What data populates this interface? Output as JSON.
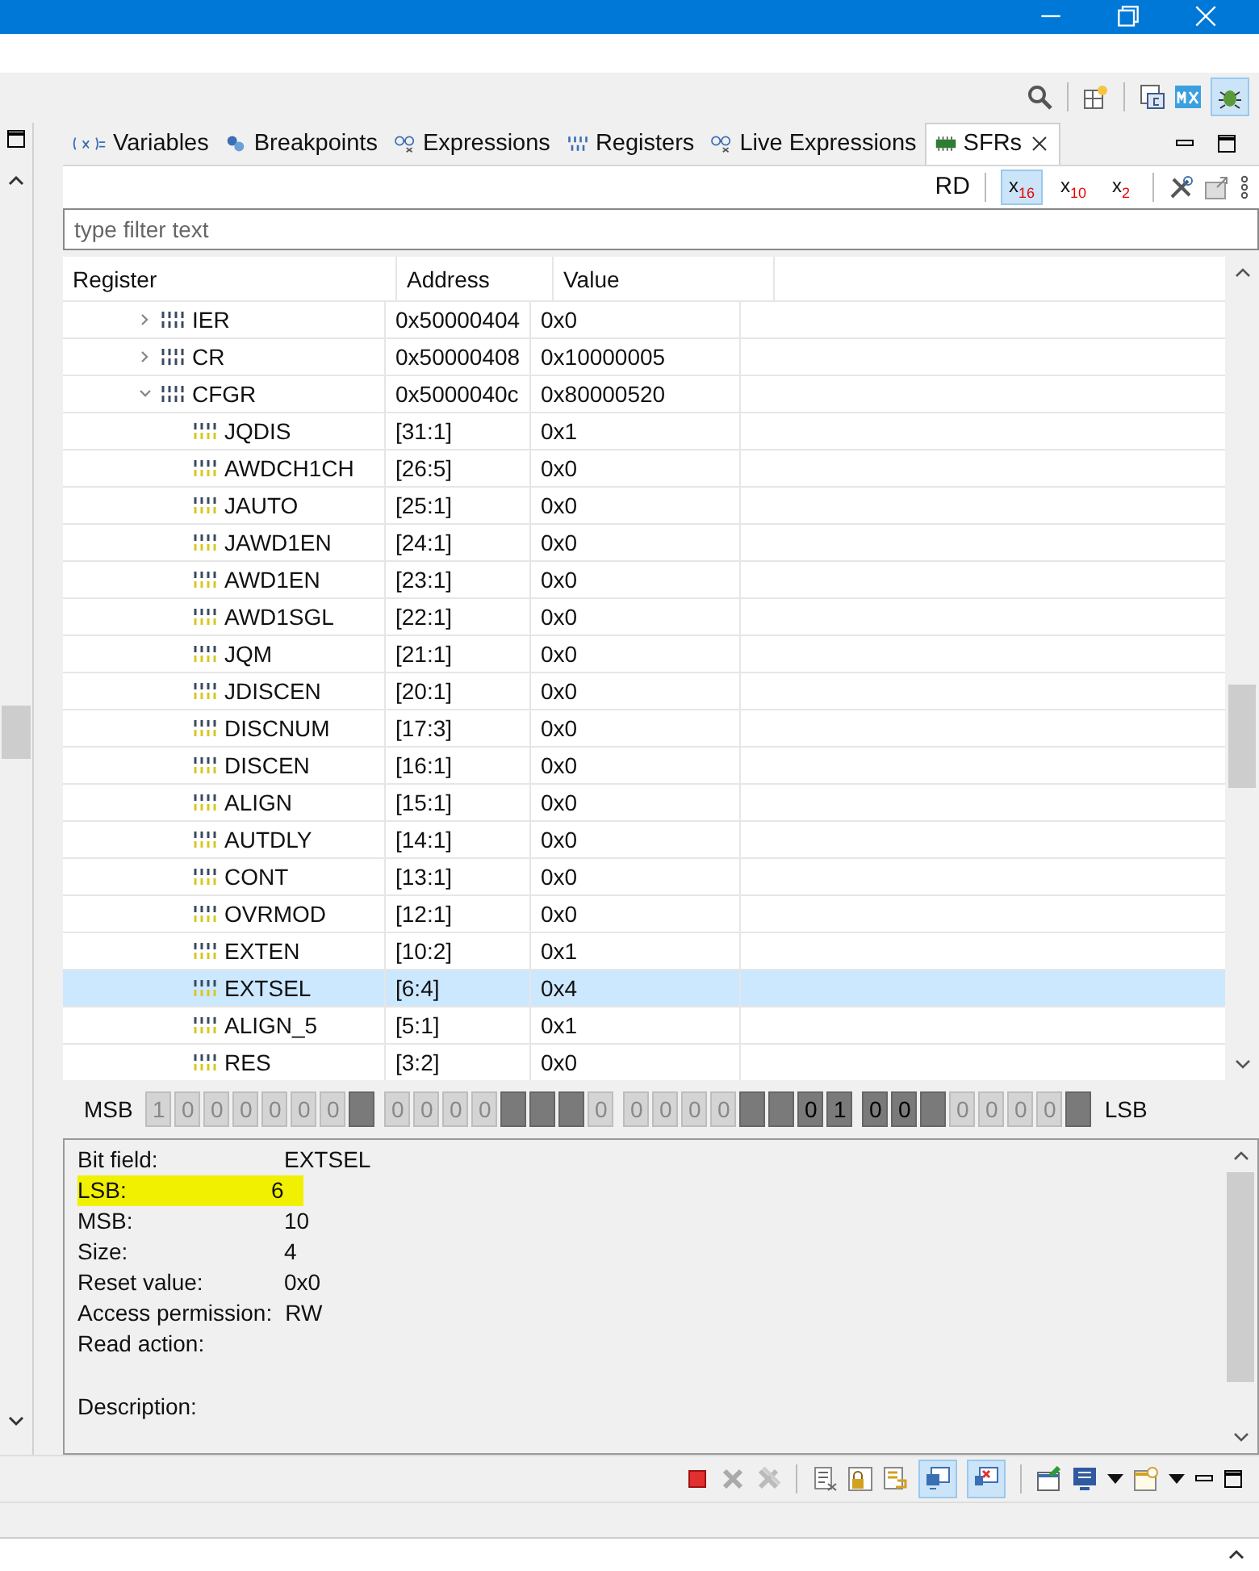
{
  "top_toolbar": {
    "debug_perspective_on": true
  },
  "tabs": [
    {
      "label": "Variables",
      "selected": false
    },
    {
      "label": "Breakpoints",
      "selected": false
    },
    {
      "label": "Expressions",
      "selected": false
    },
    {
      "label": "Registers",
      "selected": false
    },
    {
      "label": "Live Expressions",
      "selected": false
    },
    {
      "label": "SFRs",
      "selected": true
    }
  ],
  "view_toolbar": {
    "rd_label": "RD",
    "formats": [
      {
        "label": "x$_{16}$",
        "selected": true
      },
      {
        "label": "x$_{10}$",
        "selected": false
      },
      {
        "label": "x$_{2}$",
        "selected": false
      }
    ]
  },
  "filter": {
    "placeholder": "type filter text"
  },
  "table": {
    "columns": [
      "Register",
      "Address",
      "Value"
    ],
    "rows": [
      {
        "name": "IER",
        "address": "0x50000404",
        "value": "0x0",
        "expanded": false,
        "selected": false
      },
      {
        "name": "CR",
        "address": "0x50000408",
        "value": "0x10000005",
        "expanded": false,
        "selected": false
      },
      {
        "name": "CFGR",
        "address": "0x5000040c",
        "value": "0x80000520",
        "expanded": true,
        "selected": false,
        "children": [
          {
            "name": "JQDIS",
            "address": "[31:1]",
            "value": "0x1",
            "selected": false
          },
          {
            "name": "AWDCH1CH",
            "address": "[26:5]",
            "value": "0x0",
            "selected": false
          },
          {
            "name": "JAUTO",
            "address": "[25:1]",
            "value": "0x0",
            "selected": false
          },
          {
            "name": "JAWD1EN",
            "address": "[24:1]",
            "value": "0x0",
            "selected": false
          },
          {
            "name": "AWD1EN",
            "address": "[23:1]",
            "value": "0x0",
            "selected": false
          },
          {
            "name": "AWD1SGL",
            "address": "[22:1]",
            "value": "0x0",
            "selected": false
          },
          {
            "name": "JQM",
            "address": "[21:1]",
            "value": "0x0",
            "selected": false
          },
          {
            "name": "JDISCEN",
            "address": "[20:1]",
            "value": "0x0",
            "selected": false
          },
          {
            "name": "DISCNUM",
            "address": "[17:3]",
            "value": "0x0",
            "selected": false
          },
          {
            "name": "DISCEN",
            "address": "[16:1]",
            "value": "0x0",
            "selected": false
          },
          {
            "name": "ALIGN",
            "address": "[15:1]",
            "value": "0x0",
            "selected": false
          },
          {
            "name": "AUTDLY",
            "address": "[14:1]",
            "value": "0x0",
            "selected": false
          },
          {
            "name": "CONT",
            "address": "[13:1]",
            "value": "0x0",
            "selected": false
          },
          {
            "name": "OVRMOD",
            "address": "[12:1]",
            "value": "0x0",
            "selected": false
          },
          {
            "name": "EXTEN",
            "address": "[10:2]",
            "value": "0x1",
            "selected": false
          },
          {
            "name": "EXTSEL",
            "address": "[6:4]",
            "value": "0x4",
            "selected": true
          },
          {
            "name": "ALIGN_5",
            "address": "[5:1]",
            "value": "0x1",
            "selected": false
          },
          {
            "name": "RES",
            "address": "[3:2]",
            "value": "0x0",
            "selected": false
          }
        ]
      }
    ]
  },
  "bit_view": {
    "msb_label": "MSB",
    "lsb_label": "LSB",
    "bits": [
      {
        "kind": "field",
        "text": "1",
        "selected": false
      },
      {
        "kind": "field",
        "text": "0",
        "selected": false
      },
      {
        "kind": "field",
        "text": "0",
        "selected": false
      },
      {
        "kind": "field",
        "text": "0",
        "selected": false
      },
      {
        "kind": "field",
        "text": "0",
        "selected": false
      },
      {
        "kind": "field",
        "text": "0",
        "selected": false
      },
      {
        "kind": "field",
        "text": "0",
        "selected": false
      },
      {
        "kind": "reserved",
        "selected": false
      },
      {
        "kind": "field",
        "text": "0",
        "selected": false
      },
      {
        "kind": "field",
        "text": "0",
        "selected": false
      },
      {
        "kind": "field",
        "text": "0",
        "selected": false
      },
      {
        "kind": "field",
        "text": "0",
        "selected": false
      },
      {
        "kind": "reserved",
        "selected": false
      },
      {
        "kind": "reserved",
        "selected": false
      },
      {
        "kind": "reserved",
        "selected": false
      },
      {
        "kind": "field",
        "text": "0",
        "selected": false
      },
      {
        "kind": "field",
        "text": "0",
        "selected": false
      },
      {
        "kind": "field",
        "text": "0",
        "selected": false
      },
      {
        "kind": "field",
        "text": "0",
        "selected": false
      },
      {
        "kind": "field",
        "text": "0",
        "selected": false
      },
      {
        "kind": "reserved",
        "selected": false
      },
      {
        "kind": "reserved",
        "selected": false
      },
      {
        "kind": "field",
        "text": "0",
        "selected": true
      },
      {
        "kind": "field",
        "text": "1",
        "selected": true
      },
      {
        "kind": "field",
        "text": "0",
        "selected": true
      },
      {
        "kind": "field",
        "text": "0",
        "selected": true
      },
      {
        "kind": "reserved",
        "selected": false
      },
      {
        "kind": "field",
        "text": "0",
        "selected": false
      },
      {
        "kind": "field",
        "text": "0",
        "selected": false
      },
      {
        "kind": "field",
        "text": "0",
        "selected": false
      },
      {
        "kind": "field",
        "text": "0",
        "selected": false
      },
      {
        "kind": "reserved",
        "selected": false
      }
    ]
  },
  "details": [
    {
      "label": "Bit field:",
      "value": "EXTSEL",
      "highlighted": false
    },
    {
      "label": "LSB:",
      "value": "6",
      "highlighted": true
    },
    {
      "label": "MSB:",
      "value": "10",
      "highlighted": false
    },
    {
      "label": "Size:",
      "value": "4",
      "highlighted": false
    },
    {
      "label": "Reset value:",
      "value": "0x0",
      "highlighted": false
    },
    {
      "label": "Access permission:",
      "value": "RW",
      "highlighted": false
    },
    {
      "label": "Read action:",
      "highlighted": false
    },
    {
      "label": "Description:",
      "highlighted": false
    }
  ],
  "console_toolbar": {
    "pinned_output_on": true,
    "pinned_error_on": true
  }
}
